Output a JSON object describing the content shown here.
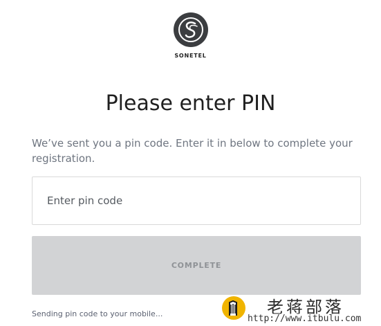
{
  "brand": {
    "name": "SONETEL",
    "logo_icon": "sonetel-s-logo-icon",
    "logo_color": "#3b3d40"
  },
  "heading": {
    "title": "Please enter PIN"
  },
  "description": {
    "text": "We’ve sent you a pin code. Enter it in below to complete your registration."
  },
  "pin_field": {
    "value": "",
    "placeholder": "Enter pin code"
  },
  "complete_button": {
    "label": "COMPLETE",
    "background": "#d2d3d5",
    "text_color": "#8f9296"
  },
  "status": {
    "text": "Sending pin code to your mobile..."
  },
  "watermark": {
    "title": "老蒋部落",
    "url": "http://www.itbulu.com",
    "icon": "pencil-badge-icon",
    "accent": "#f0b400"
  }
}
